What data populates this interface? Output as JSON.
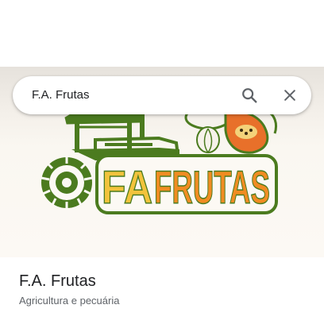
{
  "search": {
    "query": "F.A. Frutas"
  },
  "hero": {
    "logo_text_fa": "FA",
    "logo_text_frutas": "FRUTAS",
    "colors": {
      "tractor_green": "#4b7b1f",
      "logo_yellow": "#f2c33c",
      "logo_orange": "#f08c22",
      "papaya_orange": "#e8702a"
    }
  },
  "place": {
    "name": "F.A. Frutas",
    "category": "Agricultura e pecuária"
  },
  "icons": {
    "search": "search-icon",
    "close": "close-icon"
  }
}
